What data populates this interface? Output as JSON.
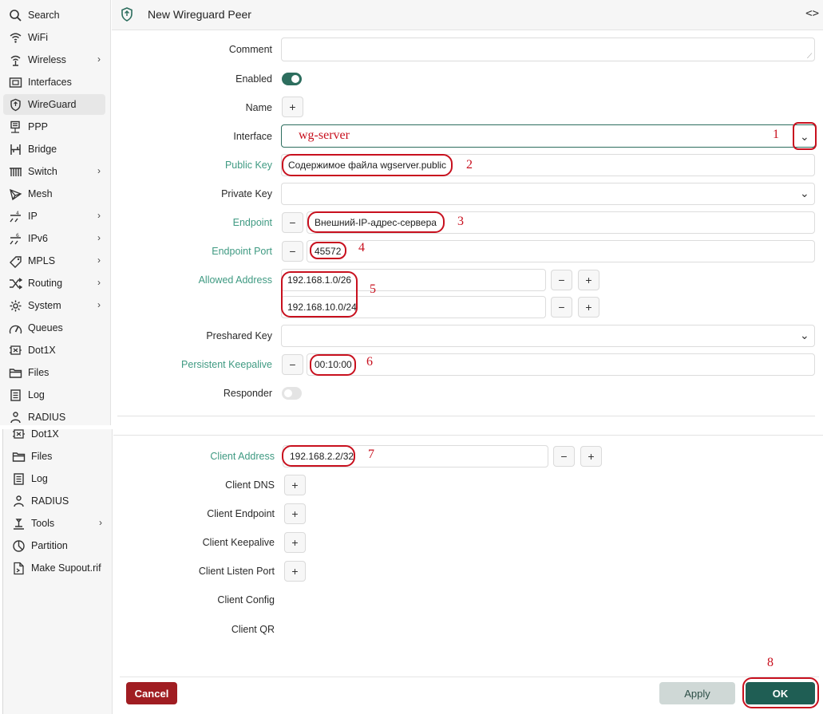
{
  "sidebar_top": [
    {
      "label": "Search",
      "icon": "search-icon"
    },
    {
      "label": "WiFi",
      "icon": "wifi-icon"
    },
    {
      "label": "Wireless",
      "icon": "wireless-icon",
      "submenu": true
    },
    {
      "label": "Interfaces",
      "icon": "interfaces-icon"
    },
    {
      "label": "WireGuard",
      "icon": "shield-icon",
      "active": true
    },
    {
      "label": "PPP",
      "icon": "ppp-icon"
    },
    {
      "label": "Bridge",
      "icon": "bridge-icon"
    },
    {
      "label": "Switch",
      "icon": "switch-icon",
      "submenu": true
    },
    {
      "label": "Mesh",
      "icon": "mesh-icon"
    },
    {
      "label": "IP",
      "icon": "ip-icon",
      "submenu": true
    },
    {
      "label": "IPv6",
      "icon": "ipv6-icon",
      "submenu": true
    },
    {
      "label": "MPLS",
      "icon": "mpls-icon",
      "submenu": true
    },
    {
      "label": "Routing",
      "icon": "routing-icon",
      "submenu": true
    },
    {
      "label": "System",
      "icon": "gear-icon",
      "submenu": true
    },
    {
      "label": "Queues",
      "icon": "queues-icon"
    },
    {
      "label": "Dot1X",
      "icon": "dot1x-icon"
    },
    {
      "label": "Files",
      "icon": "folder-icon"
    },
    {
      "label": "Log",
      "icon": "log-icon"
    },
    {
      "label": "RADIUS",
      "icon": "radius-icon"
    }
  ],
  "sidebar_bottom": [
    {
      "label": "Dot1X",
      "icon": "dot1x-icon"
    },
    {
      "label": "Files",
      "icon": "folder-icon"
    },
    {
      "label": "Log",
      "icon": "log-icon"
    },
    {
      "label": "RADIUS",
      "icon": "radius-icon"
    },
    {
      "label": "Tools",
      "icon": "tools-icon",
      "submenu": true
    },
    {
      "label": "Partition",
      "icon": "partition-icon"
    },
    {
      "label": "Make Supout.rif",
      "icon": "supout-icon"
    }
  ],
  "header": {
    "title": "New Wireguard Peer",
    "code_toggle": "<>"
  },
  "form": {
    "comment": {
      "label": "Comment",
      "value": ""
    },
    "enabled": {
      "label": "Enabled",
      "value": true
    },
    "name": {
      "label": "Name",
      "add": "+"
    },
    "interface": {
      "label": "Interface",
      "value": "wg-server"
    },
    "public_key": {
      "label": "Public Key",
      "value": "Содержимое файла wgserver.public"
    },
    "private_key": {
      "label": "Private Key",
      "value": ""
    },
    "endpoint": {
      "label": "Endpoint",
      "value": "Внешний-IP-адрес-сервера"
    },
    "endpoint_port": {
      "label": "Endpoint Port",
      "value": "45572"
    },
    "allowed_address": {
      "label": "Allowed Address",
      "values": [
        "192.168.1.0/26",
        "192.168.10.0/24"
      ]
    },
    "preshared_key": {
      "label": "Preshared Key",
      "value": ""
    },
    "persistent_keepalive": {
      "label": "Persistent Keepalive",
      "value": "00:10:00"
    },
    "responder": {
      "label": "Responder",
      "value": false
    },
    "client_address": {
      "label": "Client Address",
      "value": "192.168.2.2/32"
    },
    "client_dns": {
      "label": "Client DNS"
    },
    "client_endpoint": {
      "label": "Client Endpoint"
    },
    "client_keepalive": {
      "label": "Client Keepalive"
    },
    "client_listen_port": {
      "label": "Client Listen Port"
    },
    "client_config": {
      "label": "Client Config"
    },
    "client_qr": {
      "label": "Client QR"
    }
  },
  "controls": {
    "minus": "−",
    "plus": "+"
  },
  "annotations": [
    "1",
    "2",
    "3",
    "4",
    "5",
    "6",
    "7",
    "8"
  ],
  "footer": {
    "cancel": "Cancel",
    "apply": "Apply",
    "ok": "OK"
  },
  "colors": {
    "accent": "#2d6e5e",
    "green_label": "#3f9a82",
    "cancel": "#a01d22",
    "annotation": "#c8101e"
  }
}
